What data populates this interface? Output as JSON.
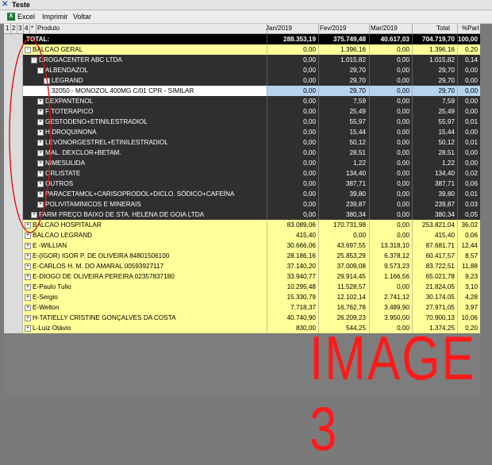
{
  "window": {
    "title": "Teste"
  },
  "menu": {
    "items": [
      "Excel",
      "Imprimir",
      "Voltar"
    ]
  },
  "columns": {
    "levels": [
      "1",
      "2",
      "3",
      "4",
      "*"
    ],
    "produto": "Produto",
    "months": [
      "Jan/2019",
      "Fev/2019",
      "Mar/2019"
    ],
    "total": "Total",
    "part": "%Part"
  },
  "rows": [
    {
      "label": "TOTAL:",
      "style": "total",
      "indent": 0,
      "exp": "",
      "jan": "288.353,19",
      "fev": "375.749,48",
      "mar": "40.617,03",
      "total": "704.719,70",
      "part": "100,00"
    },
    {
      "label": "BALCAO GERAL",
      "style": "yellow",
      "indent": 0,
      "exp": "-",
      "jan": "0,00",
      "fev": "1.396,16",
      "mar": "0,00",
      "total": "1.396,16",
      "part": "0,20"
    },
    {
      "label": "DROGACENTER ABC LTDA",
      "style": "dark",
      "indent": 1,
      "exp": "-",
      "jan": "0,00",
      "fev": "1.015,82",
      "mar": "0,00",
      "total": "1.015,82",
      "part": "0,14"
    },
    {
      "label": "ALBENDAZOL",
      "style": "dark",
      "indent": 2,
      "exp": "-",
      "jan": "0,00",
      "fev": "29,70",
      "mar": "0,00",
      "total": "29,70",
      "part": "0,00"
    },
    {
      "label": "LEGRAND",
      "style": "dark",
      "indent": 3,
      "exp": "-",
      "jan": "0,00",
      "fev": "29,70",
      "mar": "0,00",
      "total": "29,70",
      "part": "0,00"
    },
    {
      "label": "32050    - MONOZOL 400MG C/01 CPR - SIMILAR",
      "style": "sel",
      "indent": 4,
      "exp": "",
      "jan": "0,00",
      "fev": "29,70",
      "mar": "0,00",
      "total": "29,70",
      "part": "0,00"
    },
    {
      "label": "DEXPANTENOL",
      "style": "dark",
      "indent": 2,
      "exp": "+",
      "jan": "0,00",
      "fev": "7,59",
      "mar": "0,00",
      "total": "7,59",
      "part": "0,00"
    },
    {
      "label": "FITOTERAPICO",
      "style": "dark",
      "indent": 2,
      "exp": "+",
      "jan": "0,00",
      "fev": "25,49",
      "mar": "0,00",
      "total": "25,49",
      "part": "0,00"
    },
    {
      "label": "GESTODENO+ETINILESTRADIOL",
      "style": "dark",
      "indent": 2,
      "exp": "+",
      "jan": "0,00",
      "fev": "55,97",
      "mar": "0,00",
      "total": "55,97",
      "part": "0,01"
    },
    {
      "label": "HIDROQUINONA",
      "style": "dark",
      "indent": 2,
      "exp": "+",
      "jan": "0,00",
      "fev": "15,44",
      "mar": "0,00",
      "total": "15,44",
      "part": "0,00"
    },
    {
      "label": "LEVONORGESTREL+ETINILESTRADIOL",
      "style": "dark",
      "indent": 2,
      "exp": "+",
      "jan": "0,00",
      "fev": "50,12",
      "mar": "0,00",
      "total": "50,12",
      "part": "0,01"
    },
    {
      "label": "MAL. DEXCLOR+BETAM.",
      "style": "dark",
      "indent": 2,
      "exp": "+",
      "jan": "0,00",
      "fev": "28,51",
      "mar": "0,00",
      "total": "28,51",
      "part": "0,00"
    },
    {
      "label": "NIMESULIDA",
      "style": "dark",
      "indent": 2,
      "exp": "+",
      "jan": "0,00",
      "fev": "1,22",
      "mar": "0,00",
      "total": "1,22",
      "part": "0,00"
    },
    {
      "label": "ORLISTATE",
      "style": "dark",
      "indent": 2,
      "exp": "+",
      "jan": "0,00",
      "fev": "134,40",
      "mar": "0,00",
      "total": "134,40",
      "part": "0,02"
    },
    {
      "label": "OUTROS",
      "style": "dark",
      "indent": 2,
      "exp": "+",
      "jan": "0,00",
      "fev": "387,71",
      "mar": "0,00",
      "total": "387,71",
      "part": "0,06"
    },
    {
      "label": "PARACETAMOL+CARISOPRODOL+DICLO. SÓDICO+CAFEÍNA",
      "style": "dark",
      "indent": 2,
      "exp": "+",
      "jan": "0,00",
      "fev": "39,80",
      "mar": "0,00",
      "total": "39,80",
      "part": "0,01"
    },
    {
      "label": "POLIVITAMINICOS E MINERAIS",
      "style": "dark",
      "indent": 2,
      "exp": "+",
      "jan": "0,00",
      "fev": "239,87",
      "mar": "0,00",
      "total": "239,87",
      "part": "0,03"
    },
    {
      "label": "FARM PREÇO BAIXO DE STA. HELENA DE GOIA LTDA",
      "style": "dark",
      "indent": 1,
      "exp": "+",
      "jan": "0,00",
      "fev": "380,34",
      "mar": "0,00",
      "total": "380,34",
      "part": "0,05"
    },
    {
      "label": "BALCAO HOSPITALAR",
      "style": "yellow",
      "indent": 0,
      "exp": "+",
      "jan": "83.089,06",
      "fev": "170.731,98",
      "mar": "0,00",
      "total": "253.821,04",
      "part": "36,02"
    },
    {
      "label": "BALCAO LEGRAND",
      "style": "yellow",
      "indent": 0,
      "exp": "+",
      "jan": "415,40",
      "fev": "0,00",
      "mar": "0,00",
      "total": "415,40",
      "part": "0,06"
    },
    {
      "label": "E -WILLIAN",
      "style": "yellow",
      "indent": 0,
      "exp": "+",
      "jan": "30.666,06",
      "fev": "43.697,55",
      "mar": "13.318,10",
      "total": "87.681,71",
      "part": "12,44"
    },
    {
      "label": "E-(IGOR) IGOR P. DE OLIVEIRA 84801506100",
      "style": "yellow",
      "indent": 0,
      "exp": "+",
      "jan": "28.186,16",
      "fev": "25.853,29",
      "mar": "6.378,12",
      "total": "60.417,57",
      "part": "8,57"
    },
    {
      "label": "E-CARLOS H. M. DO AMARAL 00593927117",
      "style": "yellow",
      "indent": 0,
      "exp": "+",
      "jan": "37.140,20",
      "fev": "37.009,08",
      "mar": "9.573,23",
      "total": "83.722,51",
      "part": "11,88"
    },
    {
      "label": "E-DIOGO DE OLIVEIRA PEREIRA 02357837180",
      "style": "yellow",
      "indent": 0,
      "exp": "+",
      "jan": "33.940,77",
      "fev": "29.914,45",
      "mar": "1.166,56",
      "total": "65.021,78",
      "part": "9,23"
    },
    {
      "label": "E-Paulo Tulio",
      "style": "yellow",
      "indent": 0,
      "exp": "+",
      "jan": "10.295,48",
      "fev": "11.528,57",
      "mar": "0,00",
      "total": "21.824,05",
      "part": "3,10"
    },
    {
      "label": "E-Sergio",
      "style": "yellow",
      "indent": 0,
      "exp": "+",
      "jan": "15.330,79",
      "fev": "12.102,14",
      "mar": "2.741,12",
      "total": "30.174,05",
      "part": "4,28"
    },
    {
      "label": "E-Welton",
      "style": "yellow",
      "indent": 0,
      "exp": "+",
      "jan": "7.718,37",
      "fev": "16.762,78",
      "mar": "3.489,90",
      "total": "27.971,05",
      "part": "3,97"
    },
    {
      "label": "H-TATIELLY CRISTINE GONÇALVES DA COSTA",
      "style": "yellow",
      "indent": 0,
      "exp": "+",
      "jan": "40.740,90",
      "fev": "26.209,23",
      "mar": "3.950,00",
      "total": "70.900,13",
      "part": "10,06"
    },
    {
      "label": "L-Luiz Otávio",
      "style": "yellow",
      "indent": 0,
      "exp": "+",
      "jan": "830,00",
      "fev": "544,25",
      "mar": "0,00",
      "total": "1.374,25",
      "part": "0,20"
    }
  ],
  "annotation": {
    "text": "IMAGE 3",
    "color": "#ff1a1a"
  }
}
